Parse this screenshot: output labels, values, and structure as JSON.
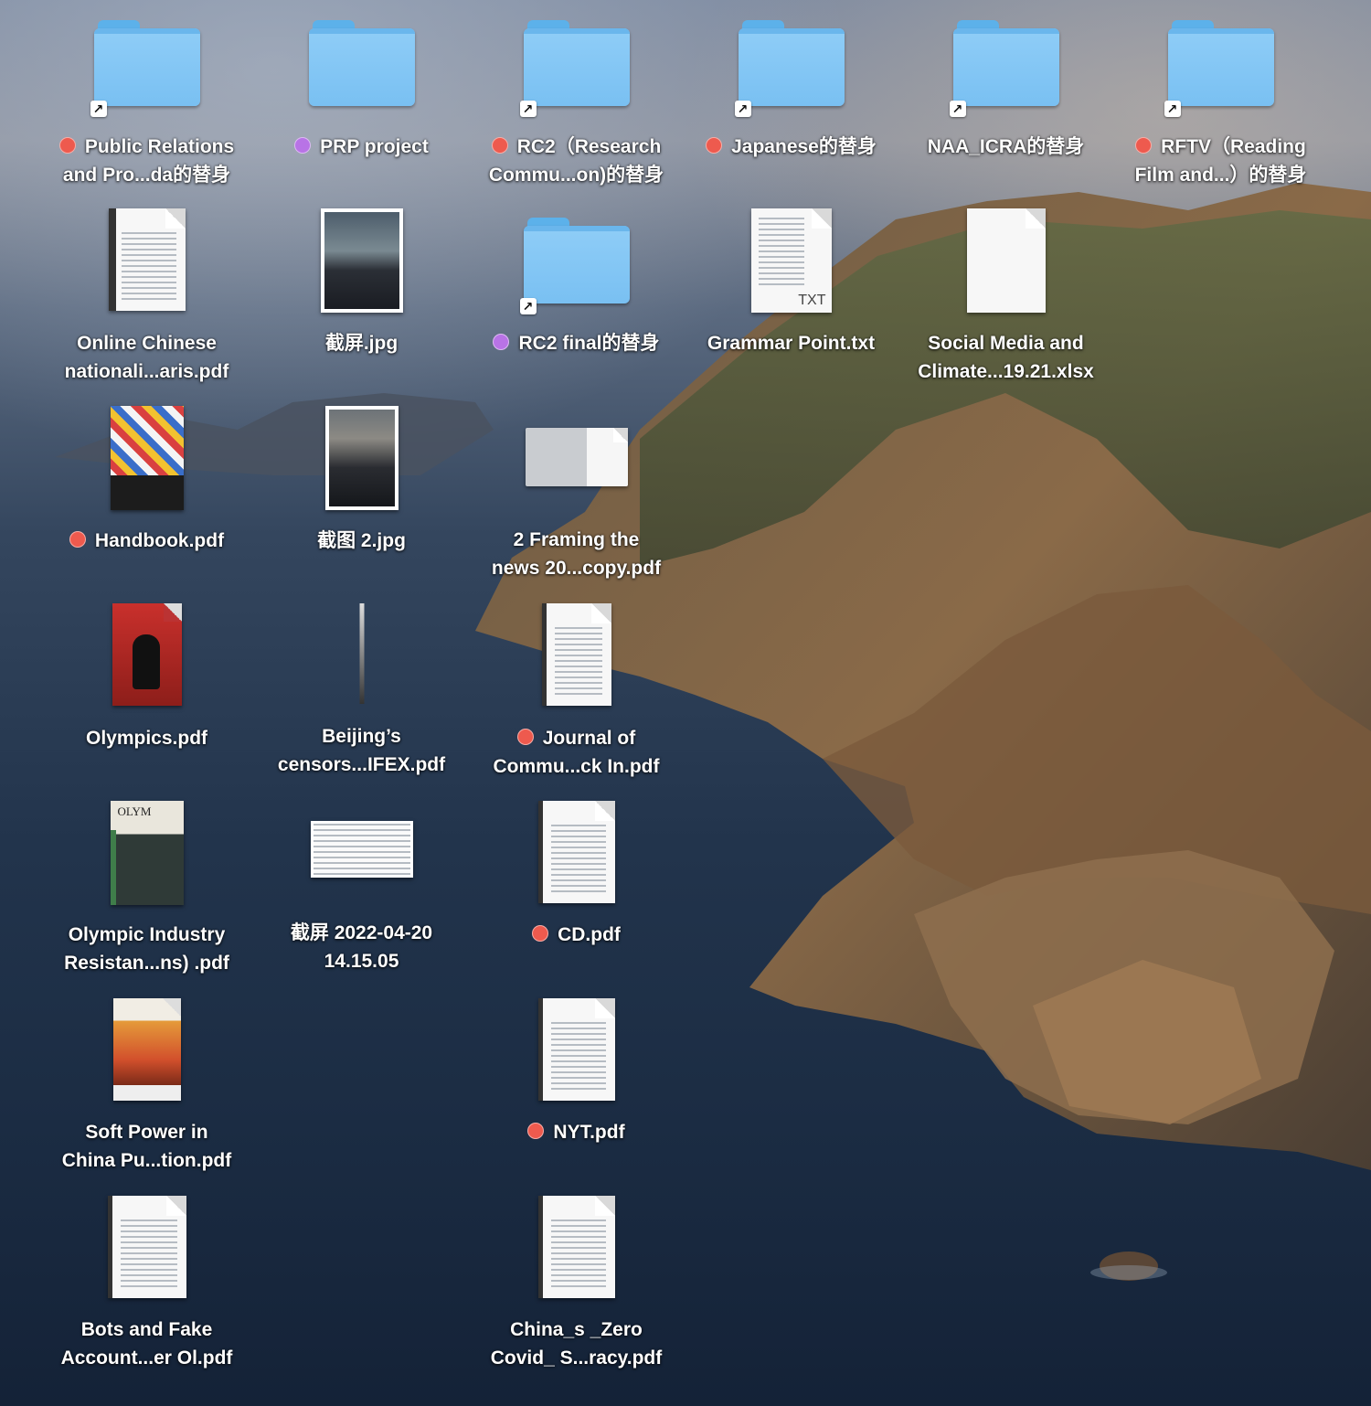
{
  "desktop": {
    "items": [
      {
        "label_lines": [
          "Public Relations",
          "and Pro...da的替身"
        ],
        "tag": "red",
        "kind": "folder",
        "alias": true
      },
      {
        "label_lines": [
          "PRP project"
        ],
        "tag": "purple",
        "kind": "folder",
        "alias": false
      },
      {
        "label_lines": [
          "RC2（Research",
          "Commu...on)的替身"
        ],
        "tag": "red",
        "kind": "folder",
        "alias": true
      },
      {
        "label_lines": [
          "Japanese的替身"
        ],
        "tag": "red",
        "kind": "folder",
        "alias": true
      },
      {
        "label_lines": [
          "NAA_ICRA的替身"
        ],
        "tag": "",
        "kind": "folder",
        "alias": true
      },
      {
        "label_lines": [
          "RFTV（Reading",
          "Film and...）的替身"
        ],
        "tag": "red",
        "kind": "folder",
        "alias": true
      },
      {
        "label_lines": [
          "Online Chinese",
          "nationali...aris.pdf"
        ],
        "tag": "",
        "kind": "pdf"
      },
      {
        "label_lines": [
          "截屏.jpg"
        ],
        "tag": "",
        "kind": "image"
      },
      {
        "label_lines": [
          "RC2 final的替身"
        ],
        "tag": "purple",
        "kind": "folder",
        "alias": true
      },
      {
        "label_lines": [
          "Grammar Point.txt"
        ],
        "tag": "",
        "kind": "txt",
        "badge": "TXT"
      },
      {
        "label_lines": [
          "Social Media and",
          "Climate...19.21.xlsx"
        ],
        "tag": "",
        "kind": "blank"
      },
      {
        "label_lines": [
          "Handbook.pdf"
        ],
        "tag": "red",
        "kind": "book-cover"
      },
      {
        "label_lines": [
          "截图 2.jpg"
        ],
        "tag": "",
        "kind": "image"
      },
      {
        "label_lines": [
          "2 Framing the",
          "news 20...copy.pdf"
        ],
        "tag": "",
        "kind": "pdf-landscape"
      },
      {
        "label_lines": [
          "Olympics.pdf"
        ],
        "tag": "",
        "kind": "book-red"
      },
      {
        "label_lines": [
          "Beijing’s",
          "censors...IFEX.pdf"
        ],
        "tag": "",
        "kind": "thin"
      },
      {
        "label_lines": [
          "Journal of",
          "Commu...ck In.pdf"
        ],
        "tag": "red",
        "kind": "pdf"
      },
      {
        "label_lines": [
          "Olympic Industry",
          "Resistan...ns) .pdf"
        ],
        "tag": "",
        "kind": "book-olympic"
      },
      {
        "label_lines": [
          "截屏 2022-04-20",
          "14.15.05"
        ],
        "tag": "",
        "kind": "screenshot"
      },
      {
        "label_lines": [
          "CD.pdf"
        ],
        "tag": "red",
        "kind": "pdf"
      },
      {
        "label_lines": [
          "Soft Power in",
          "China Pu...tion.pdf"
        ],
        "tag": "",
        "kind": "book-sunset"
      },
      {
        "label_lines": [
          "NYT.pdf"
        ],
        "tag": "red",
        "kind": "pdf"
      },
      {
        "label_lines": [
          "Bots and Fake",
          "Account...er Ol.pdf"
        ],
        "tag": "",
        "kind": "pdf"
      },
      {
        "label_lines": [
          "China_s _Zero",
          "Covid_ S...racy.pdf"
        ],
        "tag": "",
        "kind": "pdf"
      }
    ]
  },
  "colors": {
    "tag_red": "#ee5a4e",
    "tag_purple": "#b873e6",
    "folder_blue": "#79c0f2"
  }
}
